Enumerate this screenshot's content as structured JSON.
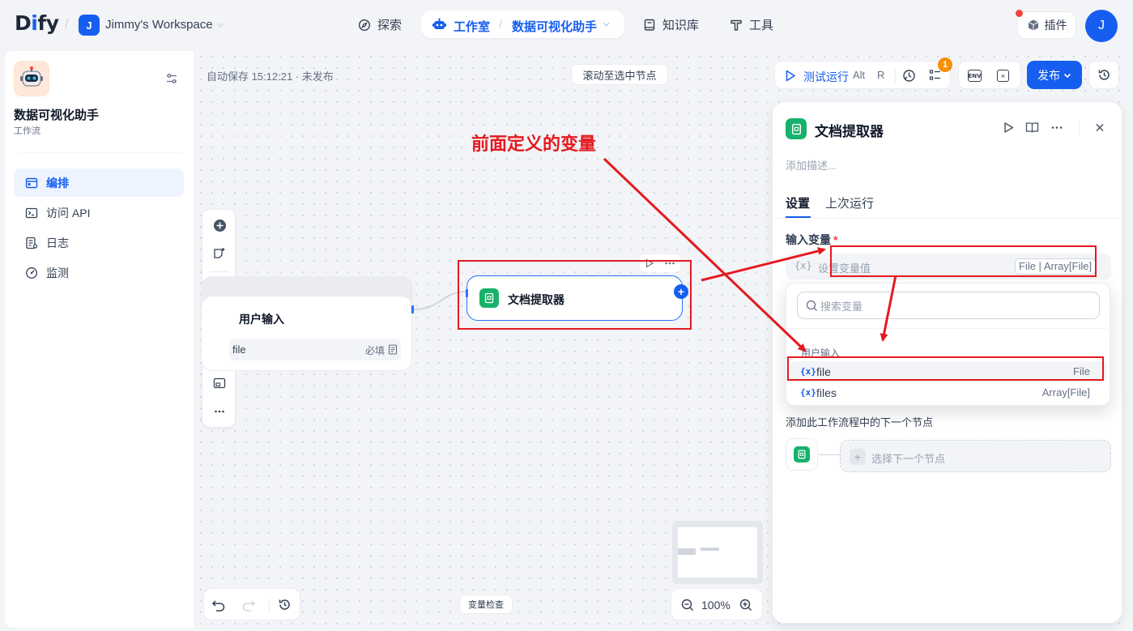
{
  "topbar": {
    "workspace_initial": "J",
    "workspace_name": "Jimmy's Workspace",
    "nav": {
      "explore": "探索",
      "studio": "工作室",
      "app": "数据可视化助手",
      "knowledge": "知识库",
      "tools": "工具"
    },
    "plugins": "插件",
    "user_initial": "J"
  },
  "sidebar": {
    "app_name": "数据可视化助手",
    "app_type": "工作流",
    "items": [
      {
        "label": "编排",
        "icon": "layout-icon",
        "active": true
      },
      {
        "label": "访问 API",
        "icon": "terminal-icon",
        "active": false
      },
      {
        "label": "日志",
        "icon": "log-icon",
        "active": false
      },
      {
        "label": "监测",
        "icon": "gauge-icon",
        "active": false
      }
    ]
  },
  "canvas": {
    "autosave": "自动保存 15:12:21 · 未发布",
    "scroll_to_node": "滚动至选中节点",
    "run_label": "测试运行",
    "run_kbd_1": "Alt",
    "run_kbd_2": "R",
    "checklist_badge": "1",
    "env_label": "ENV",
    "publish": "发布",
    "var_check": "变量检查",
    "zoom": "100%",
    "start_node": {
      "title": "用户输入",
      "var_name": "file",
      "var_required": "必填"
    },
    "doc_node": {
      "title": "文档提取器"
    },
    "annotation": "前面定义的变量"
  },
  "panel": {
    "title": "文档提取器",
    "desc_placeholder": "添加描述...",
    "tabs": [
      "设置",
      "上次运行"
    ],
    "input_label": "输入变量",
    "input_placeholder": "设置变量值",
    "input_type": "File | Array[File]",
    "next_label": "添加此工作流程中的下一个节点",
    "next_select": "选择下一个节点",
    "dropdown": {
      "search_placeholder": "搜索变量",
      "group": "用户输入",
      "items": [
        {
          "name": "file",
          "type": "File"
        },
        {
          "name": "files",
          "type": "Array[File]"
        }
      ]
    }
  },
  "colors": {
    "primary": "#155eef",
    "annotation_red": "#e5191e",
    "node_green": "#17b26a"
  }
}
